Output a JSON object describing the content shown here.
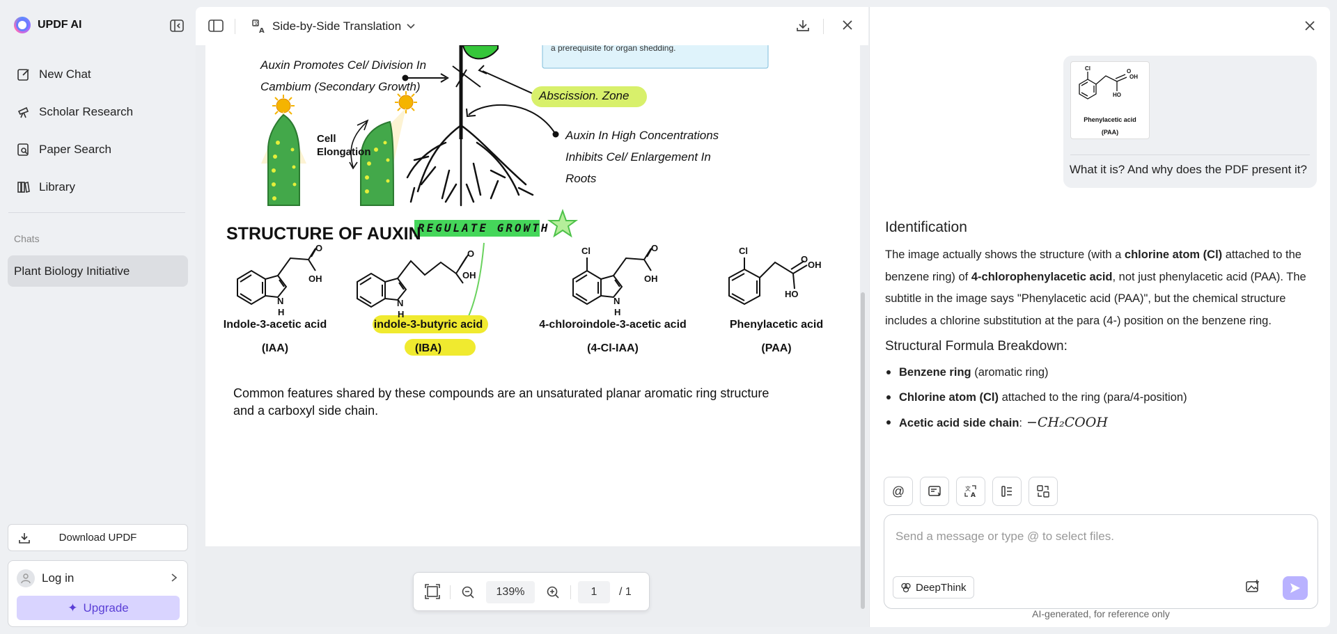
{
  "app": {
    "name": "UPDF AI"
  },
  "sidebar": {
    "nav": [
      {
        "label": "New Chat",
        "icon": "edit-icon"
      },
      {
        "label": "Scholar Research",
        "icon": "telescope-icon"
      },
      {
        "label": "Paper Search",
        "icon": "doc-search-icon"
      },
      {
        "label": "Library",
        "icon": "library-icon"
      }
    ],
    "chats_label": "Chats",
    "chats": [
      {
        "label": "Plant Biology Initiative"
      }
    ],
    "download_label": "Download UPDF",
    "login_label": "Log in",
    "upgrade_label": "Upgrade"
  },
  "pdf": {
    "mode_label": "Side-by-Side Translation",
    "page_content": {
      "annotation_1_line1": "Auxin Promotes Cel/ Division In",
      "annotation_1_line2": "Cambium (Secondary Growth)",
      "cell_elongation_1": "Cell",
      "cell_elongation_2": "Elongation",
      "abscission_zone": "Abscission. Zone",
      "annotation_2_line1": "Auxin In High Concentrations",
      "annotation_2_line2": "Inhibits Cel/ Enlargement In",
      "annotation_2_line3": "Roots",
      "info_box_text": "a prerequisite for organ shedding.",
      "structure_heading": "STRUCTURE OF AUXIN",
      "regulate_growth": "REGULATE GROWTH",
      "compounds": [
        {
          "name": "Indole-3-acetic acid",
          "abbr": "(IAA)"
        },
        {
          "name": "indole-3-butyric acid",
          "abbr": "(IBA)"
        },
        {
          "name": "4-chloroindole-3-acetic acid",
          "abbr": "(4-Cl-IAA)"
        },
        {
          "name": "Phenylacetic acid",
          "abbr": "(PAA)"
        }
      ],
      "atom_labels": {
        "oh": "OH",
        "ho": "HO",
        "n": "N",
        "h": "H",
        "cl": "Cl"
      },
      "footer_line1": "Common features shared by these compounds are an unsaturated planar aromatic ring structure",
      "footer_line2": "and a carboxyl side chain."
    },
    "zoom": "139%",
    "page_current": "1",
    "page_total": "/ 1"
  },
  "chat": {
    "user_message": {
      "thumb_caption_1": "Phenylacetic acid",
      "thumb_caption_2": "(PAA)",
      "text": "What it is? And why does the PDF present it?"
    },
    "answer": {
      "heading": "Identification",
      "p1_a": "The image actually shows the structure (with a ",
      "p1_b": "chlorine atom (Cl)",
      "p1_c": " attached to the benzene ring) of ",
      "p1_d": "4-chlorophenylacetic acid",
      "p1_e": ", not just phenylacetic acid (PAA). The subtitle in the image says \"Phenylacetic acid (PAA)\", but the chemical structure includes a chlorine substitution at the para (4-) position on the benzene ring.",
      "subheading": "Structural Formula Breakdown:",
      "bullets": [
        {
          "bold": "Benzene ring",
          "rest": " (aromatic ring)"
        },
        {
          "bold": "Chlorine atom (Cl)",
          "rest": " attached to the ring (para/4-position)"
        },
        {
          "bold": "Acetic acid side chain",
          "rest": ":"
        }
      ],
      "formula": "−CH₂COOH"
    },
    "input_placeholder": "Send a message or type @ to select files.",
    "deepthink_label": "DeepThink",
    "disclaimer": "AI-generated, for reference only"
  }
}
